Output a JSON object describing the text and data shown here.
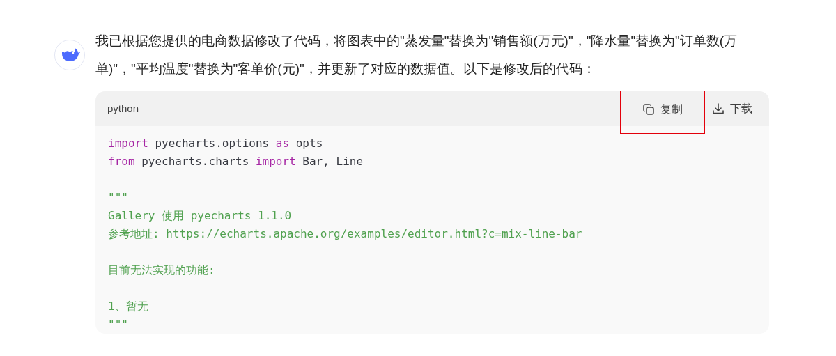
{
  "message": {
    "text": "我已根据您提供的电商数据修改了代码，将图表中的\"蒸发量\"替换为\"销售额(万元)\"，\"降水量\"替换为\"订单数(万单)\"，\"平均温度\"替换为\"客单价(元)\"，并更新了对应的数据值。以下是修改后的代码："
  },
  "code_block": {
    "language": "python",
    "actions": [
      {
        "label": "复制",
        "kind": "copy",
        "highlighted": true
      },
      {
        "label": "下载",
        "kind": "download",
        "highlighted": false
      }
    ],
    "lines": [
      {
        "kind": "code",
        "tokens": [
          {
            "kind": "keyword",
            "text": "import"
          },
          {
            "kind": "plain",
            "text": " pyecharts.options "
          },
          {
            "kind": "keyword",
            "text": "as"
          },
          {
            "kind": "plain",
            "text": " opts"
          }
        ]
      },
      {
        "kind": "code",
        "tokens": [
          {
            "kind": "keyword",
            "text": "from"
          },
          {
            "kind": "plain",
            "text": " pyecharts.charts "
          },
          {
            "kind": "keyword",
            "text": "import"
          },
          {
            "kind": "plain",
            "text": " Bar, Line"
          }
        ]
      },
      {
        "kind": "blank"
      },
      {
        "kind": "code",
        "tokens": [
          {
            "kind": "string",
            "text": "\"\"\""
          }
        ]
      },
      {
        "kind": "code",
        "tokens": [
          {
            "kind": "string",
            "text": "Gallery 使用 pyecharts 1.1.0"
          }
        ]
      },
      {
        "kind": "code",
        "tokens": [
          {
            "kind": "string",
            "text": "参考地址: https://echarts.apache.org/examples/editor.html?c=mix-line-bar"
          }
        ]
      },
      {
        "kind": "blank"
      },
      {
        "kind": "code",
        "tokens": [
          {
            "kind": "string",
            "text": "目前无法实现的功能:"
          }
        ]
      },
      {
        "kind": "blank"
      },
      {
        "kind": "code",
        "tokens": [
          {
            "kind": "string",
            "text": "1、暂无"
          }
        ]
      },
      {
        "kind": "code",
        "tokens": [
          {
            "kind": "string",
            "text": "\"\"\""
          }
        ]
      }
    ]
  }
}
